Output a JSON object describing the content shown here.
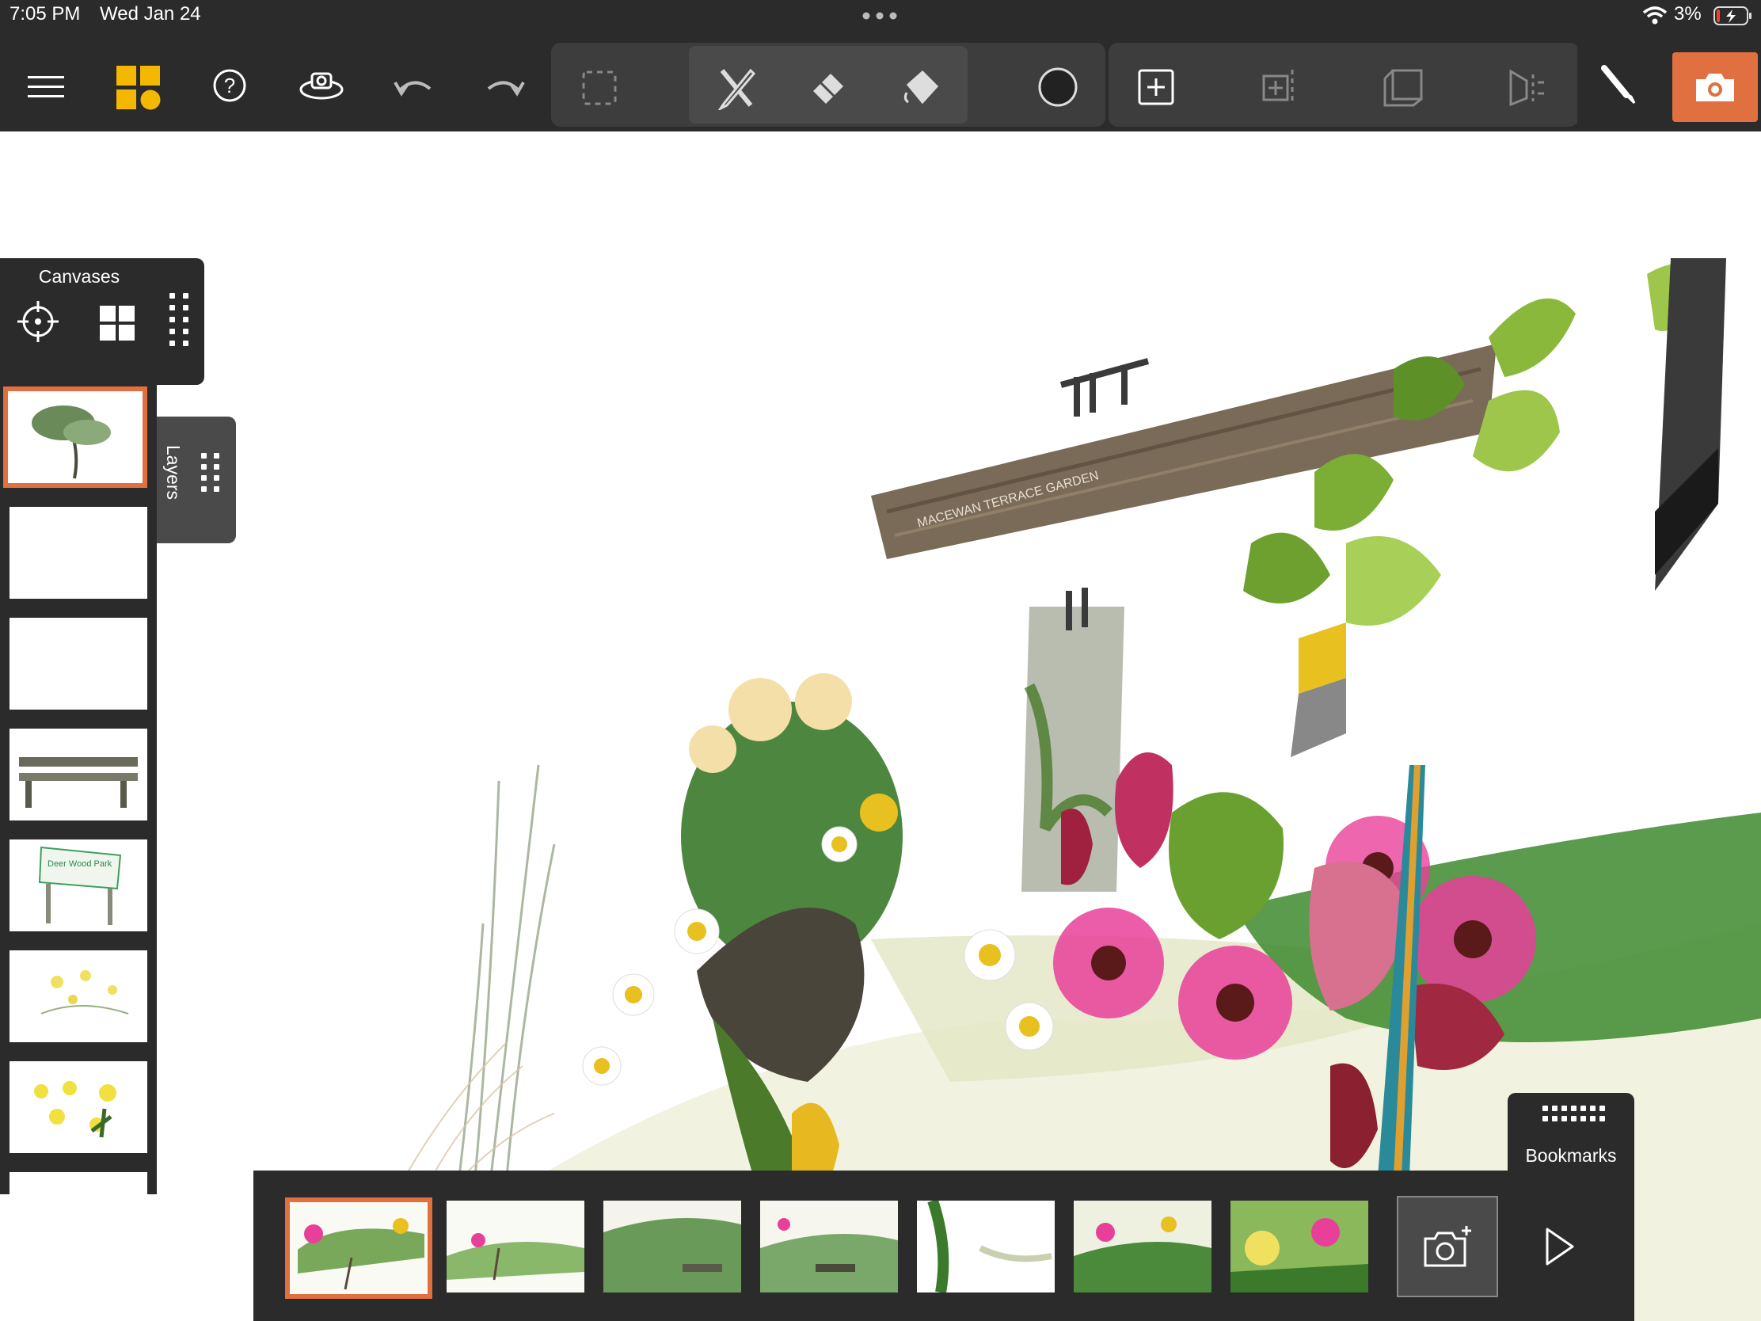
{
  "status_bar": {
    "time": "7:05 PM",
    "date": "Wed Jan 24",
    "battery": "3%"
  },
  "toolbar": {
    "accent": "#e07040",
    "app_icon_color": "#f5b800",
    "icons": [
      "menu-icon",
      "app-logo-icon",
      "help-icon",
      "rotate-view-icon",
      "undo-icon",
      "redo-icon",
      "select-icon",
      "pencil-ruler-icon",
      "eraser-icon",
      "fill-bucket-icon",
      "brush-size-icon",
      "add-canvas-icon",
      "move-canvas-icon",
      "perspective-canvas-icon",
      "mirror-canvas-icon",
      "brush-icon",
      "camera-icon"
    ]
  },
  "canvases_panel": {
    "title": "Canvases",
    "icons": [
      "target-icon",
      "grid-icon",
      "drag-handle-icon"
    ]
  },
  "layers_tab": {
    "label": "Layers"
  },
  "canvas_thumbnails": [
    "tree",
    "blank",
    "blank",
    "bench",
    "park-sign",
    "yellow-flowers-sparse",
    "yellow-flowers"
  ],
  "sign_text": {
    "park_sign": "Deer Wood Park",
    "board_text": "MACEWAN TERRACE GARDEN"
  },
  "bookmarks": {
    "label": "Bookmarks",
    "thumbnails": [
      "view-1",
      "view-2",
      "view-3",
      "view-4",
      "view-5",
      "view-6",
      "view-7"
    ]
  }
}
